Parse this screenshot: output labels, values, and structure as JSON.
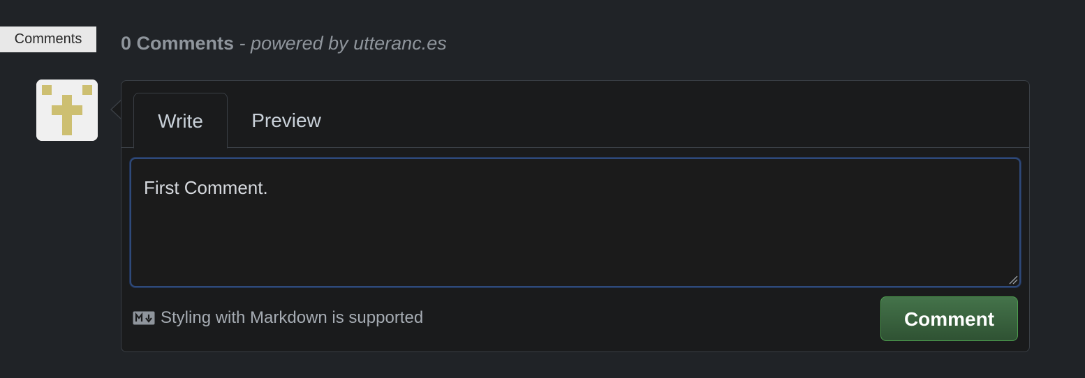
{
  "comments_chip": {
    "label": "Comments"
  },
  "header": {
    "count_text": "0 Comments",
    "separator": " - ",
    "powered_text": "powered by utteranc.es"
  },
  "avatar": {
    "icon": "cross-avatar-icon",
    "colors": {
      "background": "#f0f0f0",
      "mark": "#cdbf71"
    }
  },
  "tabs": [
    {
      "label": "Write",
      "active": true
    },
    {
      "label": "Preview",
      "active": false
    }
  ],
  "editor": {
    "value": "First Comment."
  },
  "footer": {
    "icon": "markdown-icon",
    "text": "Styling with Markdown is supported"
  },
  "actions": {
    "comment_label": "Comment"
  },
  "colors": {
    "page_bg": "#202327",
    "panel_bg": "#1a1b1c",
    "border": "#3a3f45",
    "focus_ring": "#2f4a7a",
    "button_bg": "#2f5233",
    "button_border": "#4c9b4d"
  }
}
